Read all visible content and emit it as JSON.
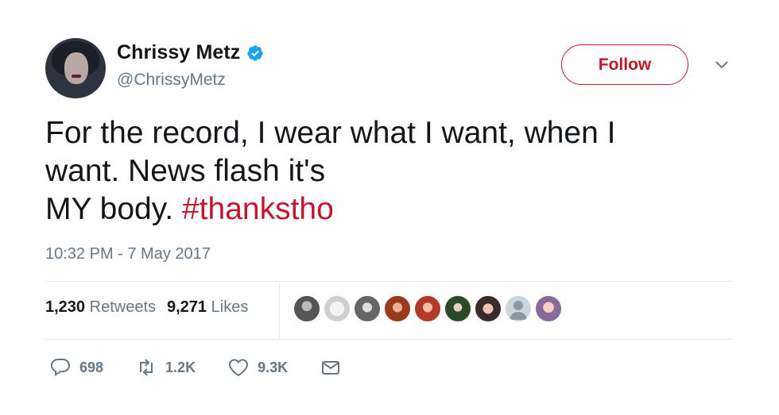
{
  "user": {
    "name": "Chrissy Metz",
    "handle": "@ChrissyMetz",
    "verified": true
  },
  "follow_button": {
    "label": "Follow"
  },
  "tweet": {
    "lines": [
      "For the record, I wear what I want, when I",
      "want. News flash it's"
    ],
    "last_line_text": "MY body. ",
    "hashtag": "#thankstho",
    "timestamp": "10:32 PM - 7 May 2017"
  },
  "stats": {
    "retweets_count": "1,230",
    "retweets_label": "Retweets",
    "likes_count": "9,271",
    "likes_label": "Likes"
  },
  "liker_avatars_count": 9,
  "actions": {
    "reply_count": "698",
    "retweet_count": "1.2K",
    "like_count": "9.3K"
  },
  "colors": {
    "accent": "#c0172c",
    "verified": "#1da1f2",
    "muted": "#657786",
    "text": "#14171a"
  },
  "icons": [
    "verified-badge-icon",
    "chevron-down-icon",
    "reply-icon",
    "retweet-icon",
    "heart-icon",
    "message-icon"
  ]
}
